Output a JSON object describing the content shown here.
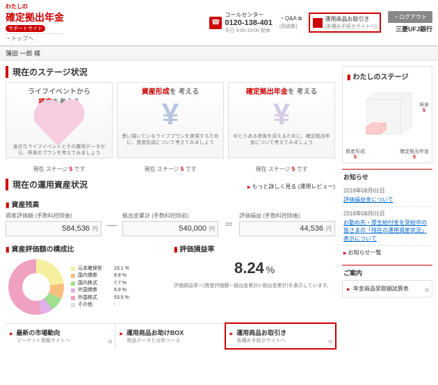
{
  "header": {
    "logoTop": "わたしの",
    "logoMain": "確定拠出年金",
    "logoSub": "サポートサイト",
    "logoLink": "・トップへ",
    "callLabel": "コールセンター",
    "callNumber": "0120-138-401",
    "callTime": "平日 9:00-19:00 祝休",
    "qa": "・Q&A",
    "qaSub": "(用語集)",
    "tradeLink": "運用商品お取引き",
    "tradeSub": "(各種お手続きサイトへ)",
    "logout": "・ログアウト",
    "bank": "三菱UFJ銀行"
  },
  "crumb": "蒲田 一郎 様",
  "stage": {
    "title": "現在のステージ状況",
    "cards": [
      {
        "titleA": "ライフイベントから",
        "em": "将来",
        "titleB": "を考える",
        "desc": "身近なライフイベントとその費用データから、将来のプランを考えてみましょう"
      },
      {
        "titleA": "",
        "em": "資産形成",
        "titleB": "を\n考える",
        "desc": "思い描いているライフプランを実現するために、資産形成について考えてみましょう"
      },
      {
        "titleA": "",
        "em": "確定拠出年金",
        "titleB": "を\n考える",
        "desc": "ゆとりある老後を迎えるために、確定拠出年金について考えてみましょう"
      }
    ],
    "status": [
      {
        "pre": "現在 ステージ",
        "num": "5",
        "post": "です"
      },
      {
        "pre": "現在 ステージ",
        "num": "5",
        "post": "です"
      },
      {
        "pre": "現在 ステージ",
        "num": "5",
        "post": "です"
      }
    ]
  },
  "assets": {
    "title": "現在の運用資産状況",
    "more": "もっと詳しく見る (運用レビュー)",
    "balanceTitle": "資産残高",
    "v1": {
      "label": "資産評価額 (手数料控除後)",
      "value": "584,536",
      "unit": "円"
    },
    "v2": {
      "label": "拠出金累計 (手数料控除前)",
      "value": "540,000",
      "unit": "円"
    },
    "v3": {
      "label": "評価損益 (手数料控除後)",
      "value": "44,536",
      "unit": "円"
    },
    "compTitle": "資産評価額の構成比",
    "legend": [
      {
        "name": "元本確保型",
        "pct": "23.1 %",
        "color": "#f5f0a0"
      },
      {
        "name": "国内債券",
        "pct": "8.8 %",
        "color": "#f8c080"
      },
      {
        "name": "国内株式",
        "pct": "7.7 %",
        "color": "#a0e090"
      },
      {
        "name": "外国債券",
        "pct": "6.9 %",
        "color": "#e0b0e8"
      },
      {
        "name": "外国株式",
        "pct": "53.5 %",
        "color": "#f0a0c0"
      },
      {
        "name": "その他",
        "pct": "-",
        "color": "#ddd"
      }
    ],
    "rateTitle": "評価損益率",
    "rateValue": "8.24",
    "ratePct": "%",
    "rateDesc": "評価損益率＝(資産評価額－拠出金累計)÷拠出金累計)を表示しています。"
  },
  "bottom": [
    {
      "title": "最新の市場動向",
      "sub": "マーケット情報サイトへ"
    },
    {
      "title": "運用商品お助けBOX",
      "sub": "商品データと分析ツール"
    },
    {
      "title": "運用商品お取引き",
      "sub": "各種お手続きサイトへ"
    }
  ],
  "side": {
    "stageTitle": "わたしのステージ",
    "axis1": "将来",
    "axis2": "資産形成",
    "axis3": "確定拠出年金",
    "axisNum": "5",
    "newsTitle": "お知らせ",
    "news": [
      {
        "date": "2018年08月01日",
        "text": "評価損益金について"
      },
      {
        "date": "2018年08月01日",
        "text": "お勤め先・厚生給付金を受給中の皆さまの「残在の運用資産状況」表示について"
      }
    ],
    "newsMore": "お知らせ一覧",
    "guideTitle": "ご案内",
    "guideBtn": "年金商品受取額試算表"
  },
  "chart_data": {
    "type": "pie",
    "title": "資産評価額の構成比",
    "series": [
      {
        "name": "構成比",
        "values": [
          23.1,
          8.8,
          7.7,
          6.9,
          53.5
        ]
      }
    ],
    "categories": [
      "元本確保型",
      "国内債券",
      "国内株式",
      "外国債券",
      "外国株式"
    ]
  }
}
